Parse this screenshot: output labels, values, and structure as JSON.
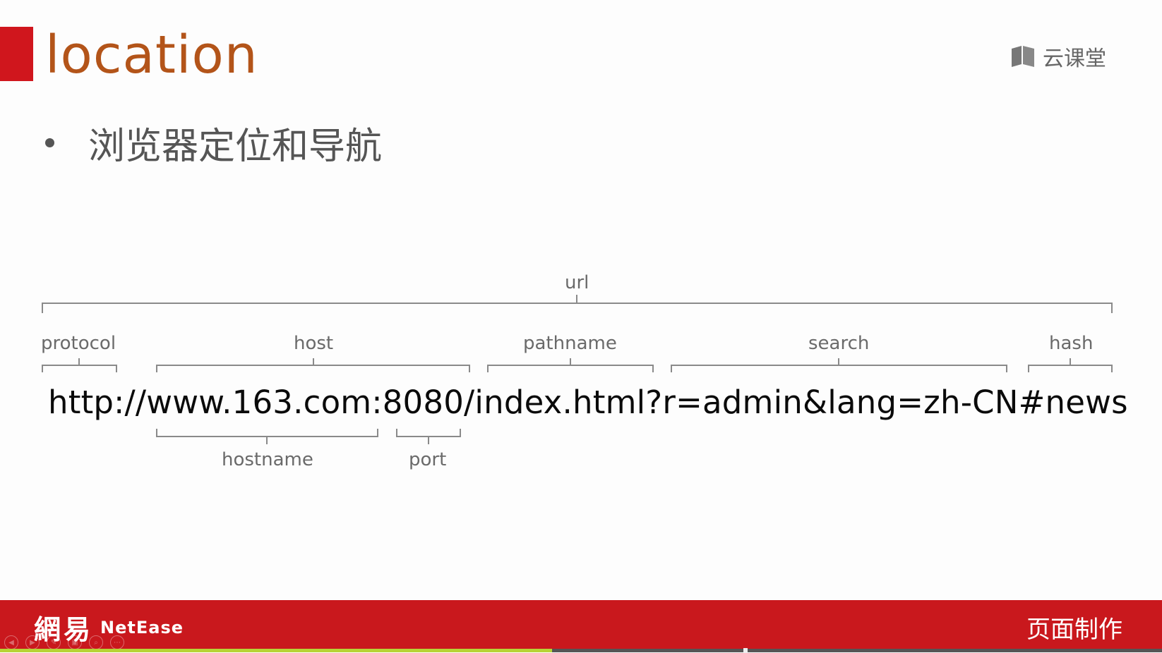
{
  "slide": {
    "title": "location",
    "brand_text": "云课堂",
    "brand_icon": "book-icon",
    "bullet": "浏览器定位和导航"
  },
  "diagram": {
    "url_label": "url",
    "full_url": "http://www.163.com:8080/index.html?r=admin&lang=zh-CN#news",
    "top_parts": [
      "protocol",
      "host",
      "pathname",
      "search",
      "hash"
    ],
    "bottom_parts": [
      "hostname",
      "port"
    ]
  },
  "footer": {
    "logo_cn": "網易",
    "logo_en": "NetEase",
    "course": "页面制作"
  },
  "player": {
    "progress": 0.475,
    "controls": [
      "prev-icon",
      "play-icon",
      "pen-icon",
      "screen-icon",
      "zoom-icon",
      "more-icon"
    ]
  },
  "colors": {
    "accent_red": "#d0161d",
    "title_brown": "#b35419",
    "footer_red": "#c9181d",
    "progress_green": "#b7d436"
  }
}
